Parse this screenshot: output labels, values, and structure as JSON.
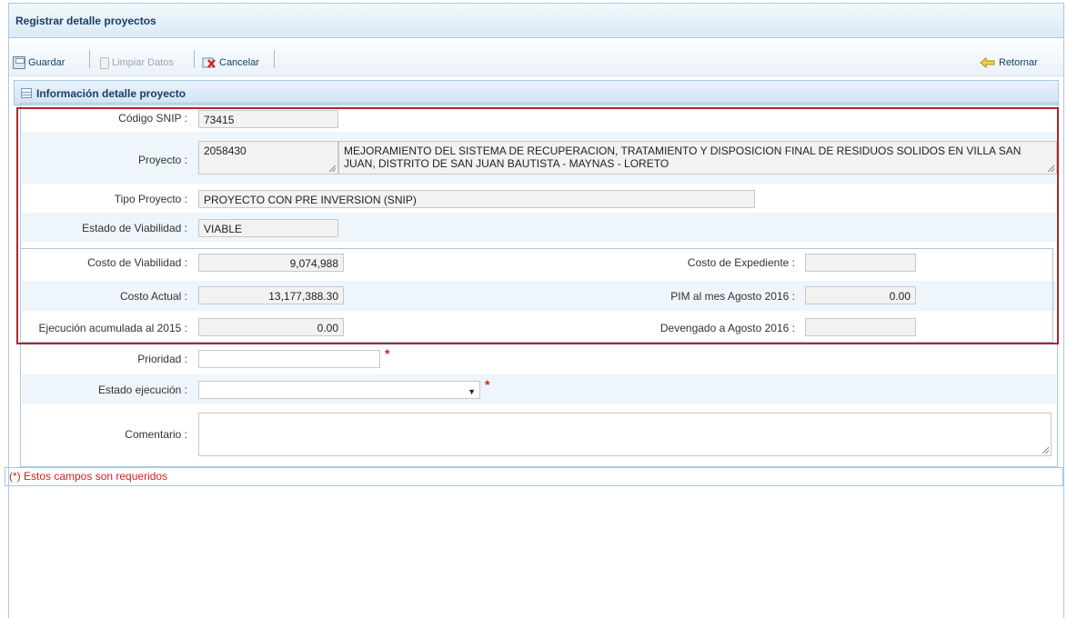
{
  "window": {
    "title": "Registrar detalle proyectos"
  },
  "toolbar": {
    "save_label": "Guardar",
    "clear_label": "Limpiar Datos",
    "cancel_label": "Cancelar",
    "back_label": "Retornar"
  },
  "section": {
    "title": "Información detalle proyecto"
  },
  "form": {
    "codigo_snip": {
      "label": "Código SNIP :",
      "value": "73415"
    },
    "proyecto": {
      "label": "Proyecto :",
      "code": "2058430",
      "name": "MEJORAMIENTO DEL SISTEMA DE RECUPERACION, TRATAMIENTO Y DISPOSICION FINAL DE RESIDUOS SOLIDOS EN VILLA SAN JUAN, DISTRITO DE SAN JUAN BAUTISTA - MAYNAS - LORETO"
    },
    "tipo_proyecto": {
      "label": "Tipo Proyecto :",
      "value": "PROYECTO CON PRE INVERSION (SNIP)"
    },
    "estado_viabilidad": {
      "label": "Estado de Viabilidad :",
      "value": "VIABLE"
    },
    "costo_viabilidad": {
      "label": "Costo de Viabilidad :",
      "value": "9,074,988"
    },
    "costo_expediente": {
      "label": "Costo de Expediente :",
      "value": ""
    },
    "costo_actual": {
      "label": "Costo Actual :",
      "value": "13,177,388.30"
    },
    "pim": {
      "label": "PIM al mes Agosto 2016 :",
      "value": "0.00"
    },
    "ejecucion_acumulada": {
      "label": "Ejecución acumulada al 2015 :",
      "value": "0.00"
    },
    "devengado": {
      "label": "Devengado a Agosto 2016 :",
      "value": ""
    },
    "prioridad": {
      "label": "Prioridad :",
      "value": ""
    },
    "estado_ejecucion": {
      "label": "Estado ejecución :",
      "value": ""
    },
    "comentario": {
      "label": "Comentario :",
      "value": ""
    },
    "required_mark": "*",
    "required_note": "(*) Estos campos son requeridos"
  },
  "colors": {
    "highlight_border": "#b1242c",
    "required": "#d42020",
    "panel_border": "#a6c9e2"
  }
}
